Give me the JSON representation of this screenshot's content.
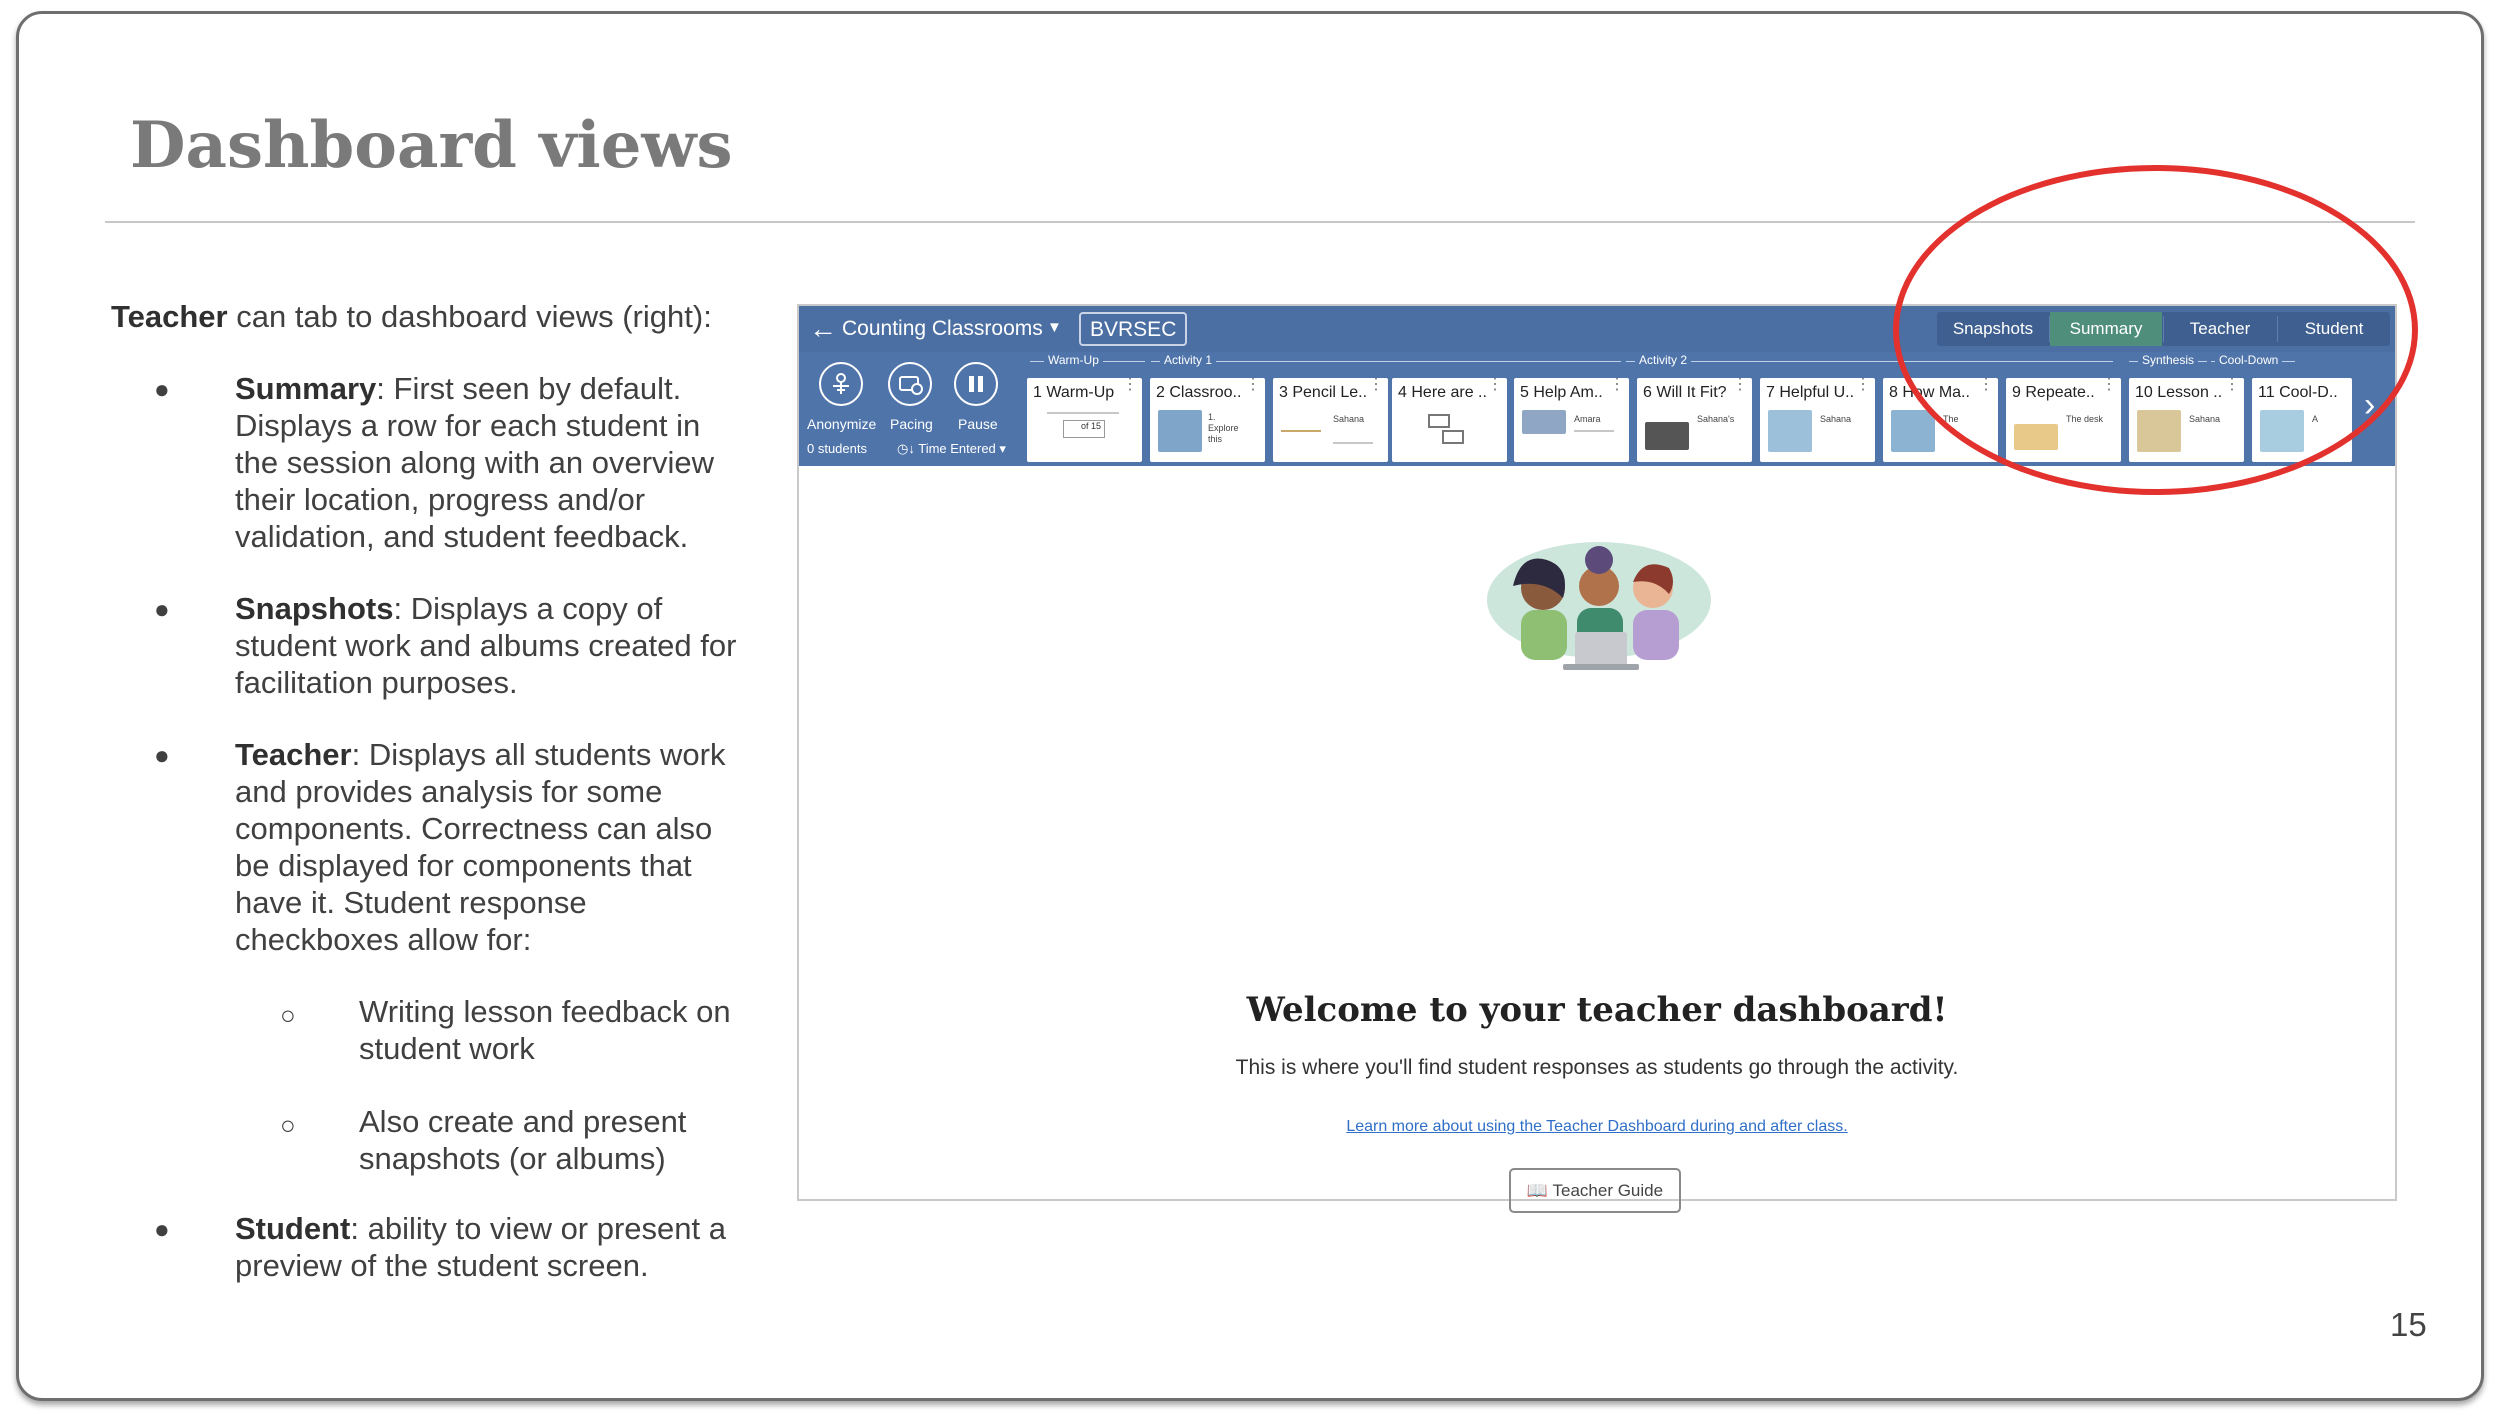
{
  "slide": {
    "title": "Dashboard views",
    "page_number": "15",
    "intro_bold": "Teacher",
    "intro_rest": " can tab to dashboard views (right):",
    "bullets": [
      {
        "bold": "Summary",
        "lines": [
          ": First seen by default.",
          "Displays a row for each student in",
          "the session along with an overview",
          "their location, progress and/or",
          "validation, and student feedback."
        ]
      },
      {
        "bold": "Snapshots",
        "lines": [
          ": Displays a copy of",
          "student work and albums created for",
          "facilitation purposes."
        ]
      },
      {
        "bold": "Teacher",
        "lines": [
          ": Displays all students work",
          "and provides analysis for some",
          "components. Correctness can also",
          "be displayed for components that",
          "have it. Student response",
          "checkboxes allow for:"
        ]
      },
      {
        "bold": "Student",
        "lines": [
          ": ability to view or present a",
          "preview of the student screen."
        ]
      }
    ],
    "sub_bullets": [
      {
        "lines": [
          "Writing lesson feedback on",
          "student work"
        ]
      },
      {
        "lines": [
          "Also create and present",
          "snapshots (or albums)"
        ]
      }
    ],
    "bullet_glyph": "●",
    "sub_bullet_glyph": "○"
  },
  "dashboard": {
    "class_name": "Counting Classrooms",
    "class_code": "BVRSEC",
    "view_tabs": [
      "Snapshots",
      "Summary",
      "Teacher",
      "Student"
    ],
    "active_tab": "Summary",
    "controls": [
      "Anonymize",
      "Pacing",
      "Pause"
    ],
    "students_count": "0 students",
    "sort_label": "Time Entered",
    "sections": [
      "Warm-Up",
      "Activity 1",
      "Activity 2",
      "Synthesis",
      "Cool-Down"
    ],
    "lessons": [
      {
        "num": "1",
        "label": "Warm-Up"
      },
      {
        "num": "2",
        "label": "Classroo.."
      },
      {
        "num": "3",
        "label": "Pencil Le.."
      },
      {
        "num": "4",
        "label": "Here are .."
      },
      {
        "num": "5",
        "label": "Help Am.."
      },
      {
        "num": "6",
        "label": "Will It Fit?"
      },
      {
        "num": "7",
        "label": "Helpful U.."
      },
      {
        "num": "8",
        "label": "How Ma.."
      },
      {
        "num": "9",
        "label": "Repeate.."
      },
      {
        "num": "10",
        "label": "Lesson .."
      },
      {
        "num": "11",
        "label": "Cool-D.."
      }
    ],
    "card_snippets": {
      "c1": "of 15",
      "c2a": "1.",
      "c2b": "Explore",
      "c2c": "this",
      "c3": "Sahana",
      "c5": "Amara",
      "c6": "Sahana's",
      "c7": "Sahana",
      "c8": "The",
      "c9": "The desk",
      "c10": "Sahana",
      "c11": "A"
    },
    "welcome_title": "Welcome to your teacher dashboard!",
    "welcome_subtitle": "This is where you'll find student responses as students go through the activity.",
    "learn_more_link": "Learn more about using the Teacher Dashboard during and after class.",
    "guide_button": "Teacher Guide",
    "colors": {
      "bar": "#4c6fa3",
      "active_tab": "#4f8e7a",
      "annotation": "#e3312d"
    }
  }
}
